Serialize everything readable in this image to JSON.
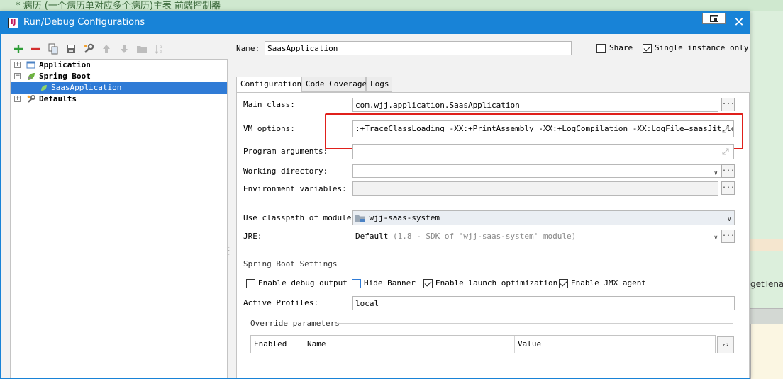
{
  "background": {
    "comment": "* 病历 (一个病历单对应多个病历)主表 前端控制器",
    "right_fragment": "getTena"
  },
  "dialog": {
    "title": "Run/Debug Configurations",
    "close_glyph": "✕"
  },
  "toolbar": {
    "icons": [
      "add-icon",
      "remove-icon",
      "copy-icon",
      "save-icon",
      "wrench-icon",
      "move-up-icon",
      "move-down-icon",
      "folder-icon",
      "sort-icon"
    ]
  },
  "tree": {
    "items": [
      {
        "label": "Application",
        "expand": "+"
      },
      {
        "label": "Spring Boot",
        "expand": "−"
      },
      {
        "label": "SaasApplication"
      },
      {
        "label": "Defaults",
        "expand": "+"
      }
    ]
  },
  "header": {
    "name_label": "Name:",
    "name_value": "SaasApplication",
    "share_label": "Share",
    "share_checked": false,
    "single_instance_label": "Single instance only",
    "single_instance_checked": true
  },
  "tabs": [
    {
      "label": "Configuration",
      "active": true
    },
    {
      "label": "Code Coverage",
      "active": false
    },
    {
      "label": "Logs",
      "active": false
    }
  ],
  "config": {
    "main_class_label": "Main class:",
    "main_class_value": "com.wjj.application.SaasApplication",
    "vm_options_label": "VM options:",
    "vm_options_value": ":+TraceClassLoading  -XX:+PrintAssembly -XX:+LogCompilation -XX:LogFile=saasJit.log",
    "program_args_label": "Program arguments:",
    "program_args_value": "",
    "working_dir_label": "Working directory:",
    "working_dir_value": "",
    "env_vars_label": "Environment variables:",
    "env_vars_value": "",
    "classpath_label": "Use classpath of module:",
    "classpath_value": "wjj-saas-system",
    "jre_label": "JRE:",
    "jre_value": "Default",
    "jre_hint": "(1.8 - SDK of 'wjj-saas-system' module)",
    "ellipsis": "..."
  },
  "spring_boot": {
    "section_title": "Spring Boot Settings",
    "enable_debug_label": "Enable debug output",
    "enable_debug_checked": false,
    "hide_banner_label": "Hide Banner",
    "hide_banner_checked": false,
    "launch_opt_label": "Enable launch optimization",
    "launch_opt_checked": true,
    "jmx_label": "Enable JMX agent",
    "jmx_checked": true,
    "active_profiles_label": "Active Profiles:",
    "active_profiles_value": "local",
    "override_title": "Override parameters",
    "columns": [
      "Enabled",
      "Name",
      "Value"
    ],
    "more_glyph": "››"
  },
  "colors": {
    "accent": "#1883d7",
    "selection": "#2f7bd6",
    "highlight": "#e0201b"
  }
}
